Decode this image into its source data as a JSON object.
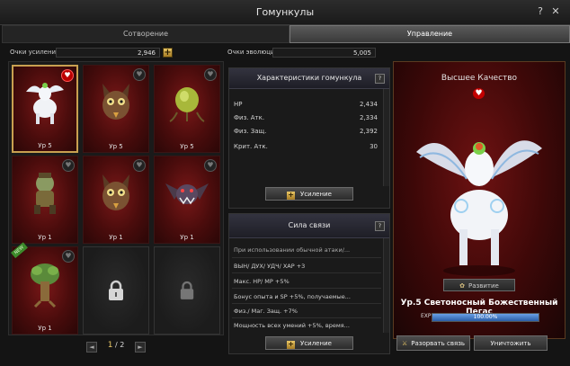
{
  "window": {
    "title": "Гомункулы",
    "help": "?",
    "close": "✕"
  },
  "tabs": [
    {
      "label": "Сотворение"
    },
    {
      "label": "Управление"
    }
  ],
  "boost_points": {
    "label": "Очки усиления",
    "value": "2,946"
  },
  "evolution_points": {
    "label": "Очки эволюции",
    "value": "5,005"
  },
  "slots": [
    {
      "level": "Ур 5",
      "favorite": true,
      "creature": "pegasus-icon"
    },
    {
      "level": "Ур 5",
      "favorite": false,
      "creature": "owl-beast-icon"
    },
    {
      "level": "Ур 5",
      "favorite": false,
      "creature": "seed-pod-icon"
    },
    {
      "level": "Ур 1",
      "favorite": false,
      "creature": "goblin-icon"
    },
    {
      "level": "Ур 1",
      "favorite": false,
      "creature": "owl-beast-icon"
    },
    {
      "level": "Ур 1",
      "favorite": false,
      "creature": "bat-demon-icon"
    },
    {
      "level": "Ур 1",
      "favorite": false,
      "creature": "treant-icon",
      "new": "NEW"
    }
  ],
  "pager": {
    "current": "1",
    "separator": "/",
    "total": "2",
    "prev": "◄",
    "next": "►"
  },
  "stats_panel": {
    "title": "Характеристики гомункула",
    "rows": [
      {
        "label": "HP",
        "value": "2,434"
      },
      {
        "label": "Физ. Атк.",
        "value": "2,334"
      },
      {
        "label": "Физ. Защ.",
        "value": "2,392"
      },
      {
        "label": "Крит. Атк.",
        "value": "30"
      }
    ],
    "button": "Усиление"
  },
  "bond_panel": {
    "title": "Сила связи",
    "rows": [
      "При использовании обычной атаки/...",
      "ВЫН/ ДУХ/ УДЧ/ ХАР +3",
      "Макс. HP/ MP +5%",
      "Бонус опыта и SP +5%, получаемые...",
      "Физ./ Маг. Защ. +7%",
      "Мощность всех умений +5%, время..."
    ],
    "button": "Усиление"
  },
  "detail": {
    "quality": "Высшее Качество",
    "develop": "Развитие",
    "name": "Ур.5 Светоносный Божественный Пегас",
    "exp_label": "EXP",
    "exp_text": "100.00%",
    "exp_fraction": 1.0
  },
  "actions": {
    "break": "Разорвать связь",
    "destroy": "Уничтожить"
  },
  "colors": {
    "accent": "#c8a050",
    "slot_bg": "#6e1212",
    "exp_bar": "#3a78c8"
  }
}
